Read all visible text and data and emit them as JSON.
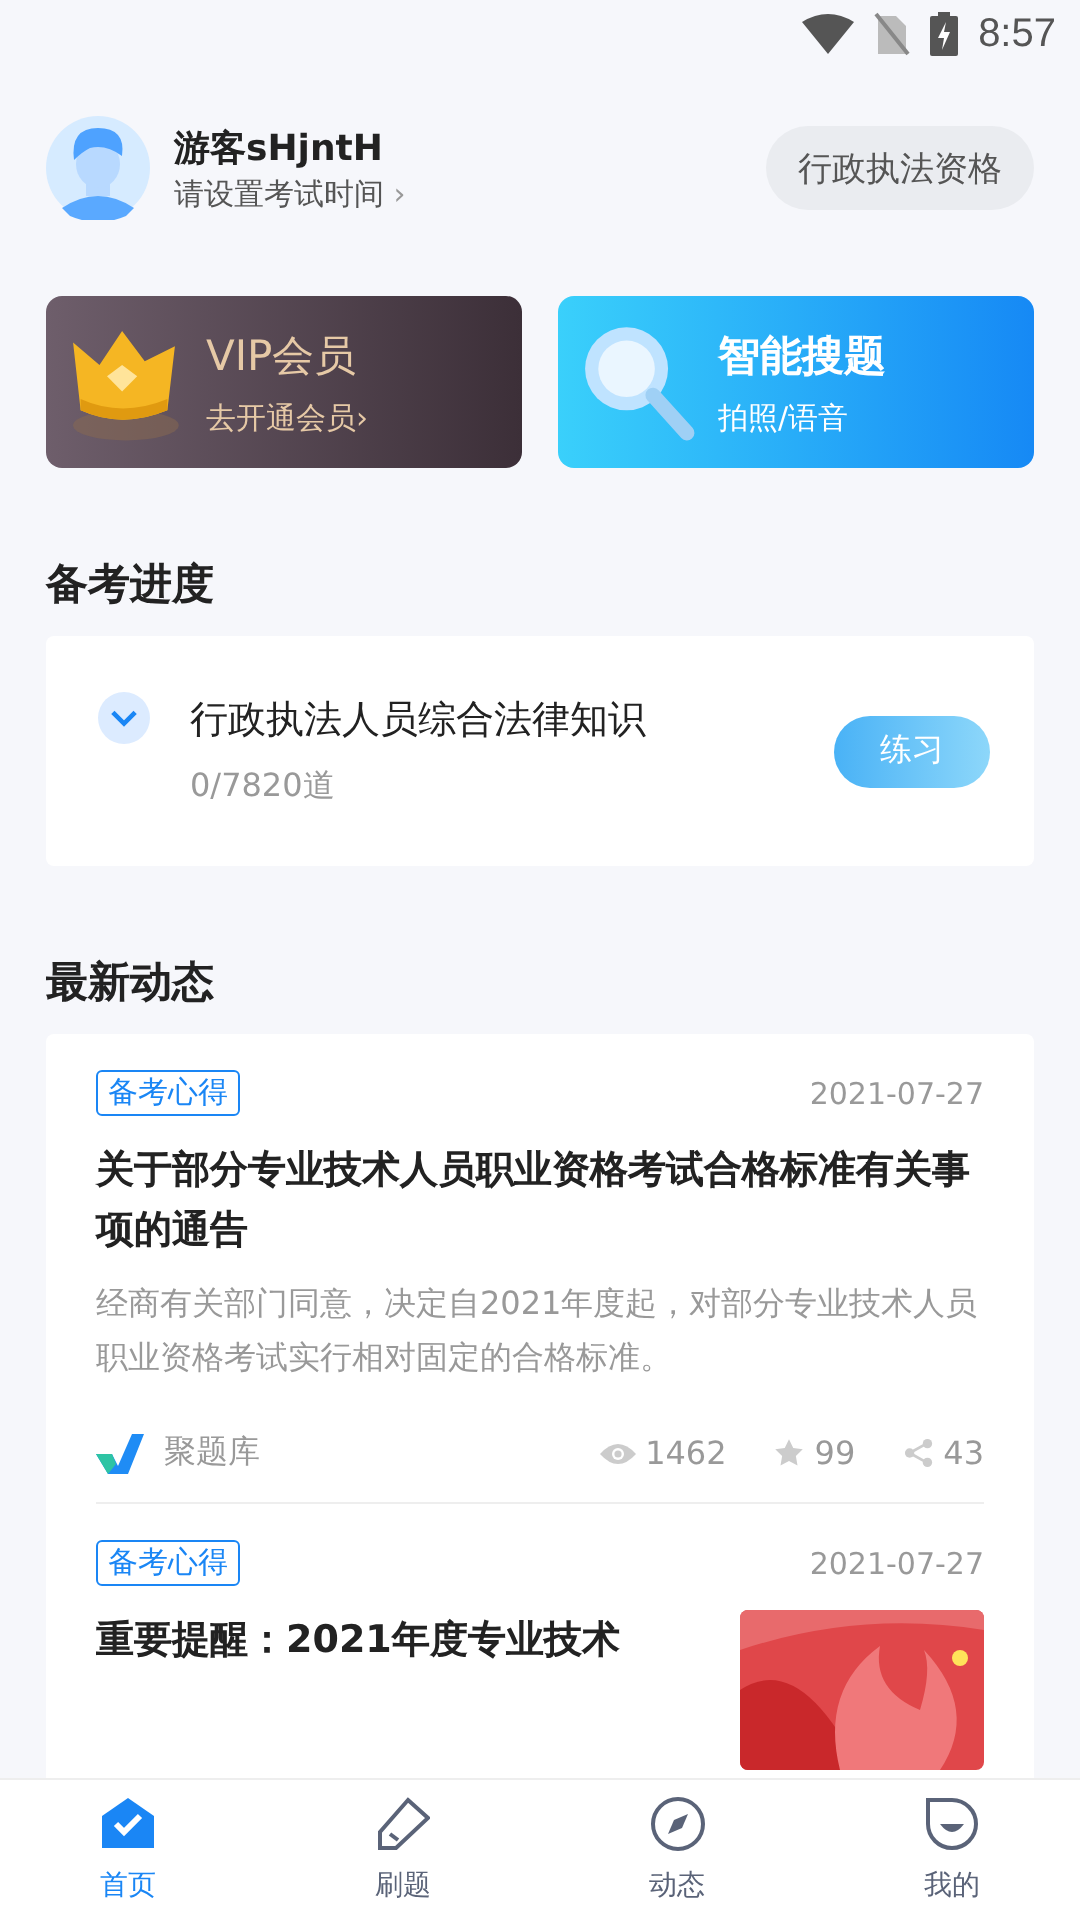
{
  "status_bar": {
    "time": "8:57"
  },
  "user": {
    "name": "游客sHjntH",
    "subtitle": "请设置考试时间",
    "chevron": "›",
    "exam_chip": "行政执法资格"
  },
  "promos": [
    {
      "kind": "vip",
      "title": "VIP会员",
      "subtitle": "去开通会员",
      "chevron": "›"
    },
    {
      "kind": "search",
      "title": "智能搜题",
      "subtitle": "拍照/语音"
    }
  ],
  "progress": {
    "heading": "备考进度",
    "subject": "行政执法人员综合法律知识",
    "count": "0/7820道",
    "expanded": false,
    "button": "练习"
  },
  "news": {
    "heading": "最新动态",
    "articles": [
      {
        "tag": "备考心得",
        "date": "2021-07-27",
        "title": "关于部分专业技术人员职业资格考试合格标准有关事项的通告",
        "summary": "经商有关部门同意，决定自2021年度起，对部分专业技术人员职业资格考试实行相对固定的合格标准。",
        "source": "聚题库",
        "views": "1462",
        "likes": "99",
        "shares": "43"
      },
      {
        "tag": "备考心得",
        "date": "2021-07-27",
        "title": "重要提醒：2021年度专业技术"
      }
    ]
  },
  "tabs": [
    {
      "label": "首页",
      "kind": "home",
      "selected": true
    },
    {
      "label": "刷题",
      "kind": "practice",
      "selected": false
    },
    {
      "label": "动态",
      "kind": "feed",
      "selected": false
    },
    {
      "label": "我的",
      "kind": "profile",
      "selected": false
    }
  ]
}
